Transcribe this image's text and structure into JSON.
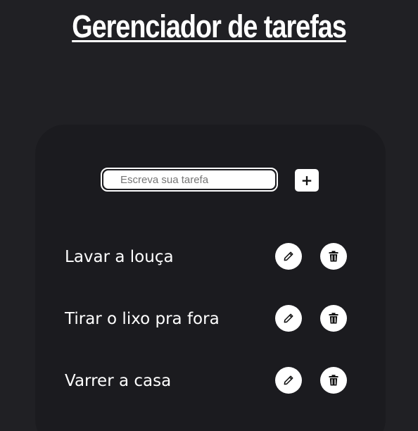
{
  "app": {
    "title": "Gerenciador de tarefas"
  },
  "new_task": {
    "placeholder": "Escreva sua tarefa",
    "value": "",
    "add_label": "+"
  },
  "tasks": [
    {
      "label": "Lavar a louça",
      "edit_icon": "pencil-icon",
      "delete_icon": "trash-icon"
    },
    {
      "label": "Tirar o lixo pra fora",
      "edit_icon": "pencil-icon",
      "delete_icon": "trash-icon"
    },
    {
      "label": "Varrer a casa",
      "edit_icon": "pencil-icon",
      "delete_icon": "trash-icon"
    }
  ],
  "colors": {
    "background": "#202024",
    "card": "#1b1b1f",
    "text": "#ffffff",
    "button": "#ffffff"
  }
}
